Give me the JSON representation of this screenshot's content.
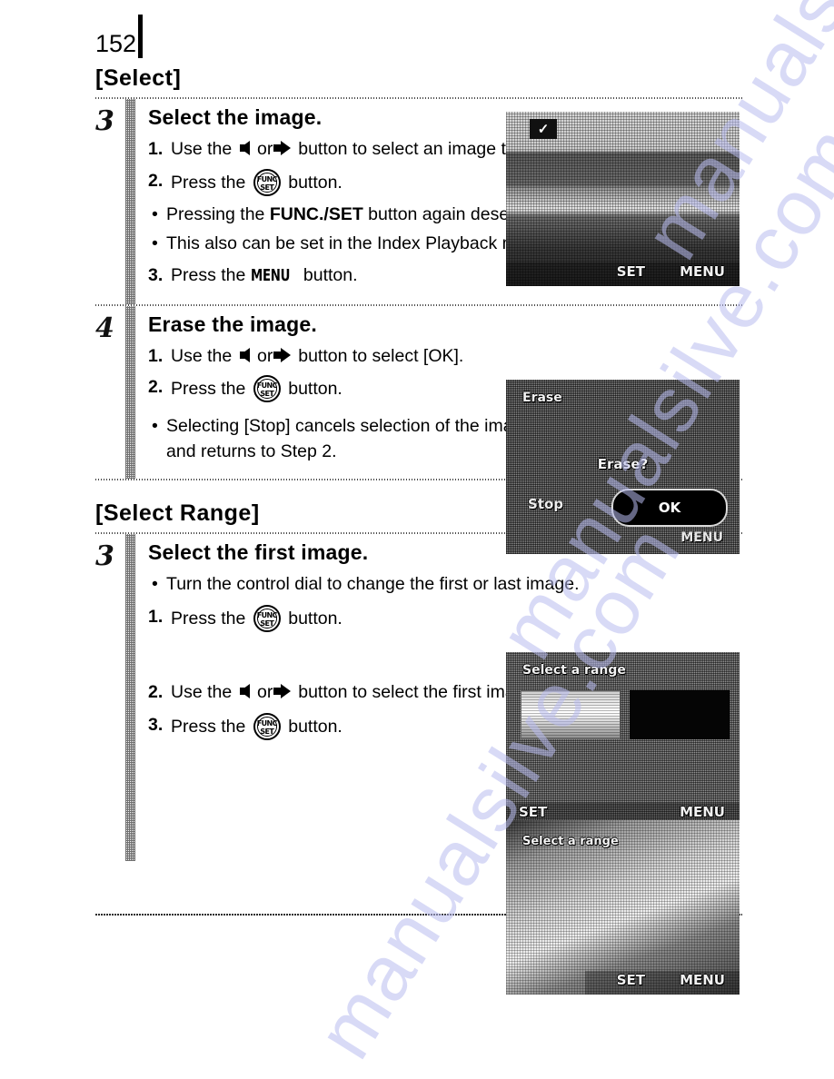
{
  "page": {
    "number": "152"
  },
  "sections": [
    {
      "title": "[Select]",
      "steps": [
        {
          "number": "3",
          "heading": "Select the image.",
          "items": [
            {
              "kind": "num",
              "marker": "1.",
              "prefix": "Use the",
              "arrows": true,
              "suffix": "button to select an image to erase."
            },
            {
              "kind": "num",
              "marker": "2.",
              "prefix": "Press the",
              "icon": "func-set-icon",
              "suffix": "button."
            },
            {
              "kind": "bullet",
              "prefix": "Pressing the",
              "bold": "FUNC./SET",
              "suffix": "button again deselects the setting."
            },
            {
              "kind": "bullet",
              "text": "This also can be set in the Index Playback mode."
            },
            {
              "kind": "num",
              "marker": "3.",
              "prefix": "Press the",
              "keyword": "MENU",
              "suffix": "button."
            }
          ]
        },
        {
          "number": "4",
          "heading": "Erase the image.",
          "items": [
            {
              "kind": "num",
              "marker": "1.",
              "prefix": "Use the",
              "arrows": true,
              "suffix": "button to select [OK]."
            },
            {
              "kind": "num",
              "marker": "2.",
              "prefix": "Press the",
              "icon": "func-set-icon",
              "suffix": "button."
            },
            {
              "kind": "bullet",
              "text": "Selecting [Stop] cancels selection of the image you are about to erase and returns to Step 2."
            }
          ]
        }
      ]
    },
    {
      "title": "[Select Range]",
      "steps": [
        {
          "number": "3",
          "heading": "Select the first image.",
          "items": [
            {
              "kind": "bullet",
              "text": "Turn the control dial to change the first or last image."
            },
            {
              "kind": "num",
              "marker": "1.",
              "prefix": "Press the",
              "icon": "func-set-icon",
              "suffix": "button."
            },
            {
              "kind": "num",
              "marker": "2.",
              "prefix": "Use the",
              "arrows": true,
              "suffix": "button to select the first image for the range to erase."
            },
            {
              "kind": "num",
              "marker": "3.",
              "prefix": "Press the",
              "icon": "func-set-icon",
              "suffix": "button."
            }
          ]
        }
      ]
    }
  ],
  "icons": {
    "func_set_top": "FUNC",
    "func_set_bottom": "SET",
    "arrow_left": "left-arrow",
    "arrow_right": "right-arrow",
    "check": "✓"
  },
  "screens": [
    {
      "id": "screen-select-image",
      "check_badge": "✓",
      "hint_set": "SET",
      "hint_menu": "MENU"
    },
    {
      "id": "screen-erase-confirm",
      "title": "Erase",
      "prompt": "Erase?",
      "stop_label": "Stop",
      "ok_label": "OK",
      "hint_menu": "MENU"
    },
    {
      "id": "screen-select-first",
      "title": "Select a range",
      "hint_set": "SET",
      "hint_menu": "MENU"
    },
    {
      "id": "screen-first-image",
      "title": "Select a range",
      "hint_set": "SET",
      "hint_menu": "MENU"
    }
  ],
  "watermark": {
    "line1": "manualsilve.com",
    "line2": "manualsilve.com",
    "line3": "manualsilve.com"
  },
  "colors": {
    "ink": "#000000",
    "paper": "#ffffff",
    "watermark": "#b9bcf0",
    "screen_gray": "#8e8e8e"
  }
}
